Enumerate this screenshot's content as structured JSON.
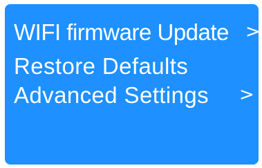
{
  "menu": {
    "items": [
      {
        "label": "WIFI firmware Update",
        "chevron": ">"
      },
      {
        "label": "Restore Defaults"
      },
      {
        "label": "Advanced Settings",
        "chevron": ">"
      }
    ]
  },
  "colors": {
    "background": "#1e90ff",
    "text": "#ffffff"
  }
}
